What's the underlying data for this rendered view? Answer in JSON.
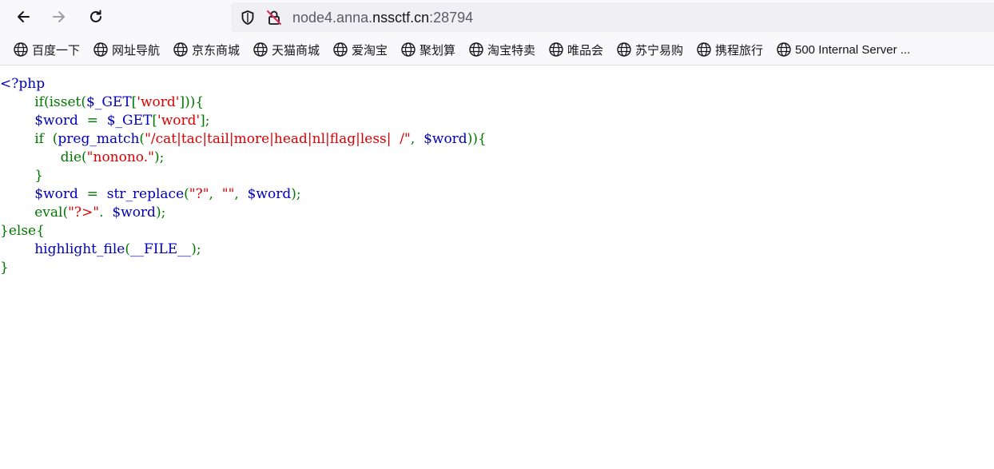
{
  "browser": {
    "url_prefix": "node4.anna.",
    "url_domain": "nssctf.cn",
    "url_port": ":28794",
    "icons": {
      "back": "back-arrow-icon",
      "forward": "forward-arrow-icon",
      "reload": "reload-icon",
      "shield": "tracking-protection-shield-icon",
      "insecure": "insecure-connection-lock-icon"
    }
  },
  "bookmarks": [
    {
      "label": "百度一下",
      "icon": "globe-icon"
    },
    {
      "label": "网址导航",
      "icon": "globe-icon"
    },
    {
      "label": "京东商城",
      "icon": "globe-icon"
    },
    {
      "label": "天猫商城",
      "icon": "globe-icon"
    },
    {
      "label": "爱淘宝",
      "icon": "globe-icon"
    },
    {
      "label": "聚划算",
      "icon": "globe-icon"
    },
    {
      "label": "淘宝特卖",
      "icon": "globe-icon"
    },
    {
      "label": "唯品会",
      "icon": "globe-icon"
    },
    {
      "label": "苏宁易购",
      "icon": "globe-icon"
    },
    {
      "label": "携程旅行",
      "icon": "globe-icon"
    },
    {
      "label": "500 Internal Server ...",
      "icon": "globe-icon"
    }
  ],
  "code": {
    "colors": {
      "default": "#0000bb",
      "keyword": "#007700",
      "string": "#dd0000"
    },
    "lines": [
      [
        {
          "t": "<?php",
          "c": "def"
        }
      ],
      [
        {
          "t": "        if(isset(",
          "c": "kw"
        },
        {
          "t": "$_GET",
          "c": "def"
        },
        {
          "t": "[",
          "c": "kw"
        },
        {
          "t": "'word'",
          "c": "str"
        },
        {
          "t": "])){",
          "c": "kw"
        }
      ],
      [
        {
          "t": "        $word  ",
          "c": "def"
        },
        {
          "t": "=  ",
          "c": "kw"
        },
        {
          "t": "$_GET",
          "c": "def"
        },
        {
          "t": "[",
          "c": "kw"
        },
        {
          "t": "'word'",
          "c": "str"
        },
        {
          "t": "];",
          "c": "kw"
        }
      ],
      [
        {
          "t": "        if  (",
          "c": "kw"
        },
        {
          "t": "preg_match",
          "c": "def"
        },
        {
          "t": "(",
          "c": "kw"
        },
        {
          "t": "\"/cat|tac|tail|more|head|nl|flag|less|  /\"",
          "c": "str"
        },
        {
          "t": ",  ",
          "c": "kw"
        },
        {
          "t": "$word",
          "c": "def"
        },
        {
          "t": ")){",
          "c": "kw"
        }
      ],
      [
        {
          "t": "              die(",
          "c": "kw"
        },
        {
          "t": "\"nonono.\"",
          "c": "str"
        },
        {
          "t": ");",
          "c": "kw"
        }
      ],
      [
        {
          "t": "        }",
          "c": "kw"
        }
      ],
      [
        {
          "t": "        $word  ",
          "c": "def"
        },
        {
          "t": "=  ",
          "c": "kw"
        },
        {
          "t": "str_replace",
          "c": "def"
        },
        {
          "t": "(",
          "c": "kw"
        },
        {
          "t": "\"?\"",
          "c": "str"
        },
        {
          "t": ",  ",
          "c": "kw"
        },
        {
          "t": "\"\"",
          "c": "str"
        },
        {
          "t": ",  ",
          "c": "kw"
        },
        {
          "t": "$word",
          "c": "def"
        },
        {
          "t": ");",
          "c": "kw"
        }
      ],
      [
        {
          "t": "        eval(",
          "c": "kw"
        },
        {
          "t": "\"?>\"",
          "c": "str"
        },
        {
          "t": ".  ",
          "c": "kw"
        },
        {
          "t": "$word",
          "c": "def"
        },
        {
          "t": ");",
          "c": "kw"
        }
      ],
      [
        {
          "t": "}else{",
          "c": "kw"
        }
      ],
      [
        {
          "t": "        ",
          "c": "def"
        },
        {
          "t": "highlight_file",
          "c": "def"
        },
        {
          "t": "(",
          "c": "kw"
        },
        {
          "t": "__FILE__",
          "c": "def"
        },
        {
          "t": ");",
          "c": "kw"
        }
      ],
      [
        {
          "t": "}",
          "c": "kw"
        }
      ]
    ]
  }
}
